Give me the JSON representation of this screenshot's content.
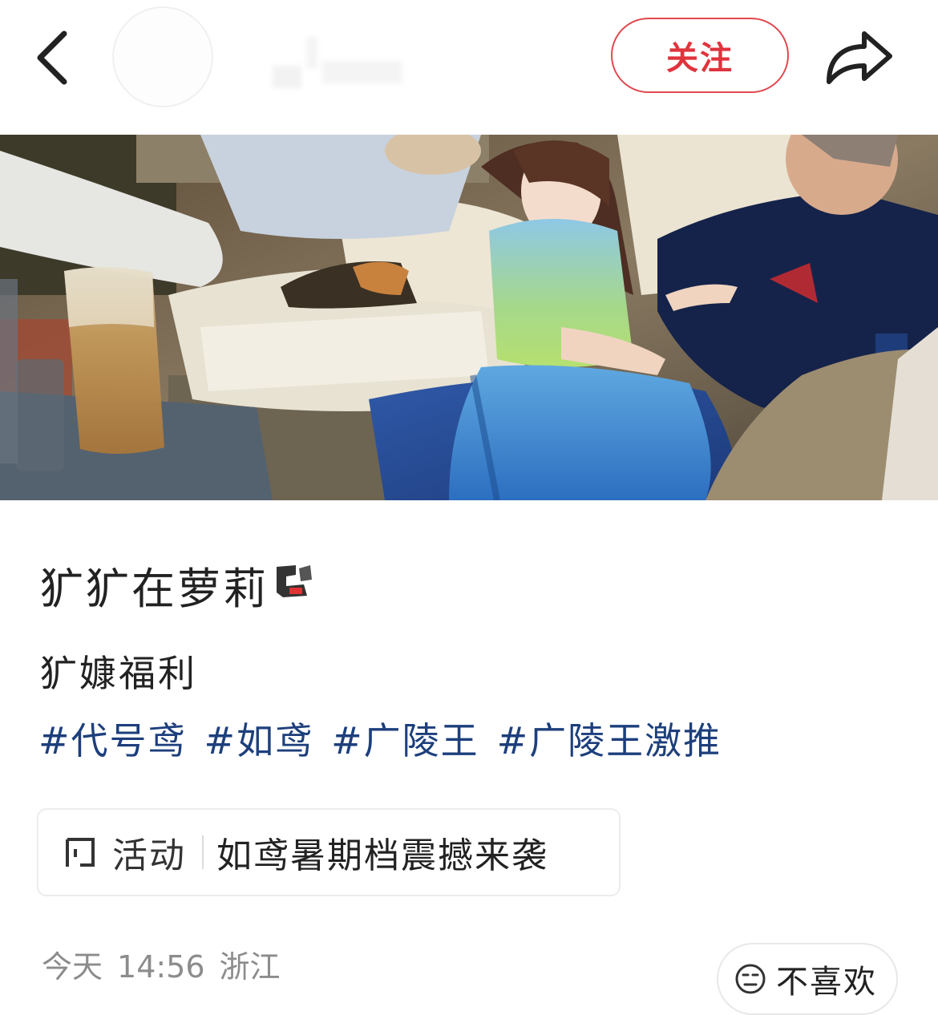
{
  "header": {
    "follow_label": "关注"
  },
  "post": {
    "title": "犷犷在萝莉",
    "subtitle": "犷嫝福利",
    "tags": [
      "#代号鸢",
      "#如鸢",
      "#广陵王",
      "#广陵王激推"
    ],
    "activity": {
      "label": "活动",
      "title": "如鸢暑期档震撼来袭"
    },
    "meta": {
      "date": "今天",
      "time": "14:56",
      "location": "浙江"
    },
    "dislike_label": "不喜欢"
  }
}
